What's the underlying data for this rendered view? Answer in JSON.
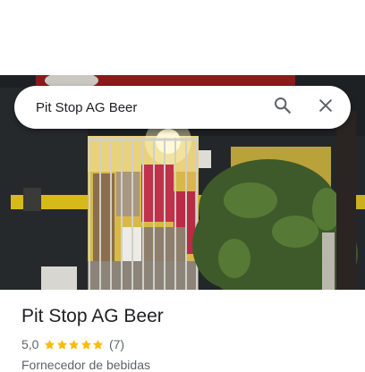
{
  "search": {
    "query": "Pit Stop AG Beer"
  },
  "place": {
    "name": "Pit Stop AG Beer",
    "rating": "5,0",
    "stars": 5,
    "review_count": "(7)",
    "category": "Fornecedor de bebidas"
  },
  "colors": {
    "star": "#fbbc04",
    "text_primary": "#202124",
    "text_secondary": "#5f6368"
  },
  "icons": {
    "search": "search-icon",
    "close": "close-icon",
    "star": "star-icon"
  }
}
